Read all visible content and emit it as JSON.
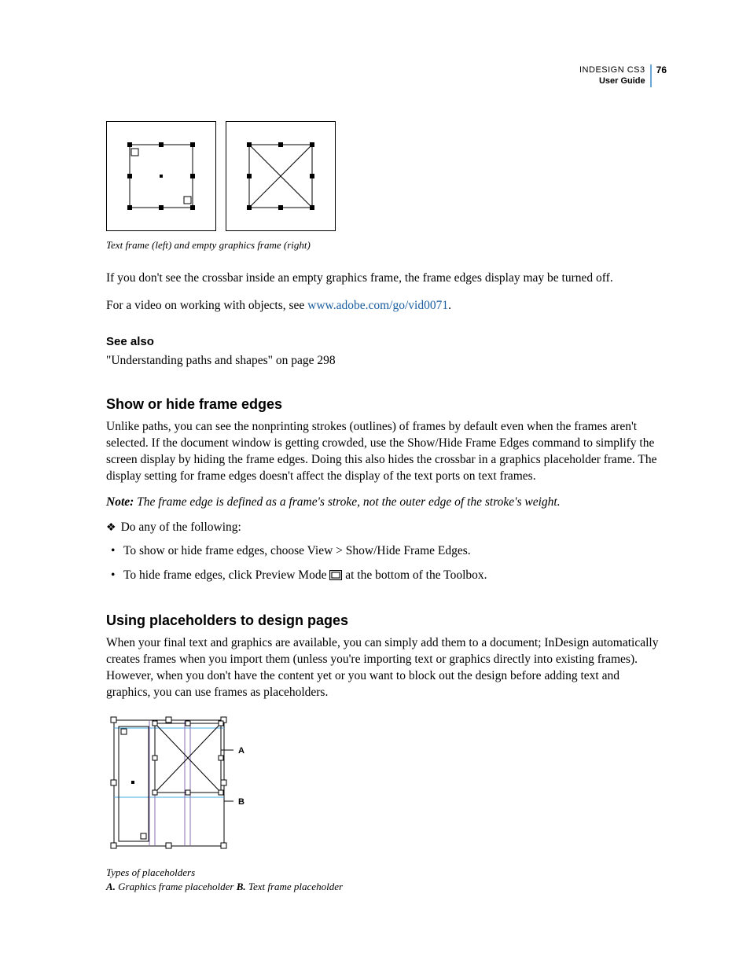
{
  "header": {
    "product": "INDESIGN CS3",
    "guide": "User Guide",
    "page": "76"
  },
  "fig1_caption": "Text frame (left) and empty graphics frame (right)",
  "para1": "If you don't see the crossbar inside an empty graphics frame, the frame edges display may be turned off.",
  "para2_pre": "For a video on working with objects, see ",
  "para2_link": "www.adobe.com/go/vid0071",
  "para2_post": ".",
  "seealso_title": "See also",
  "seealso_ref": "\"Understanding paths and shapes\" on page 298",
  "section1_title": "Show or hide frame edges",
  "section1_body": "Unlike paths, you can see the nonprinting strokes (outlines) of frames by default even when the frames aren't selected. If the document window is getting crowded, use the Show/Hide Frame Edges command to simplify the screen display by hiding the frame edges. Doing this also hides the crossbar in a graphics placeholder frame. The display setting for frame edges doesn't affect the display of the text ports on text frames.",
  "note_label": "Note:",
  "note_text": " The frame edge is defined as a frame's stroke, not the outer edge of the stroke's weight.",
  "do_any": "Do any of the following:",
  "bullet1": "To show or hide frame edges, choose View > Show/Hide Frame Edges.",
  "bullet2_pre": "To hide frame edges, click Preview Mode ",
  "bullet2_post": " at the bottom of the Toolbox.",
  "section2_title": "Using placeholders to design pages",
  "section2_body": "When your final text and graphics are available, you can simply add them to a document; InDesign automatically creates frames when you import them (unless you're importing text or graphics directly into existing frames). However, when you don't have the content yet or you want to block out the design before adding text and graphics, you can use frames as placeholders.",
  "fig2": {
    "title": "Types of placeholders",
    "A_label": "A.",
    "A_text": " Graphics frame placeholder  ",
    "B_label": "B.",
    "B_text": " Text frame placeholder",
    "callout_A": "A",
    "callout_B": "B"
  }
}
